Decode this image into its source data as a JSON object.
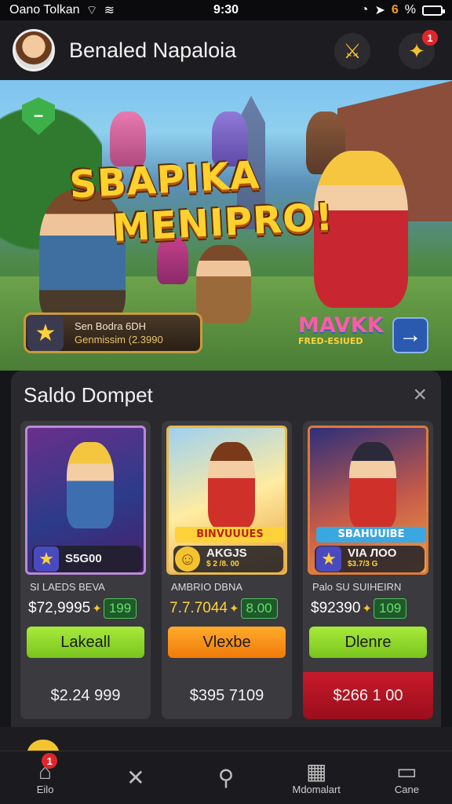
{
  "status_bar": {
    "carrier": "Oano Tolkan",
    "time": "9:30",
    "battery_text": "6 ",
    "battery_pct": "%"
  },
  "header": {
    "title": "Benaled Napaloia",
    "notification_count": "1",
    "icons": [
      "avatar",
      "sword-icon",
      "bell-icon"
    ]
  },
  "hero": {
    "title_line1": "SBAPIKA",
    "title_line2": "MENIРRO!",
    "shield_symbol": "−",
    "promo_line1": "Sen Bodra 6DH",
    "promo_line2": "Genmissim (2.3990",
    "badge_title": "MAVKK",
    "badge_sub": "FRED-ESIUED",
    "arrow": "→"
  },
  "wallet": {
    "title": "Saldo Dompet",
    "close": "×",
    "cards": [
      {
        "pill_amount": "S5G00",
        "label": "SI LAEDS BEVA",
        "price": "$72,9995",
        "badge": "199",
        "button": "Lakeall",
        "footer": "$2.24 999"
      },
      {
        "banner": "BINVUUUES",
        "pill_amount": "AKGJS",
        "pill_sub": "$ 2 /8. 00",
        "label": "AMBRIO DBNA",
        "price": "7.7.7044",
        "badge": "8.00",
        "button": "Vlexbe",
        "footer": "$395 7109"
      },
      {
        "banner": "SBAHUUIBE",
        "pill_amount": "VIA ЛОО",
        "pill_sub": "$3.7/3 G",
        "label": "Palo SU SUIHEIRN",
        "price": "$92390",
        "badge": "109",
        "button": "Dlenre",
        "footer": "$266 1 00"
      }
    ]
  },
  "bottom_nav": {
    "items": [
      {
        "label": "Eilo",
        "icon": "home-icon"
      },
      {
        "label": "",
        "icon": "close-icon"
      },
      {
        "label": "",
        "icon": "search-icon"
      },
      {
        "label": "Mdomalart",
        "icon": "store-icon"
      },
      {
        "label": "Cane",
        "icon": "game-icon"
      }
    ],
    "home_badge": "1"
  },
  "colors": {
    "accent_yellow": "#ffd12e",
    "green_button": "#8fd828",
    "orange_button": "#f8921a",
    "red_footer": "#b81424"
  }
}
